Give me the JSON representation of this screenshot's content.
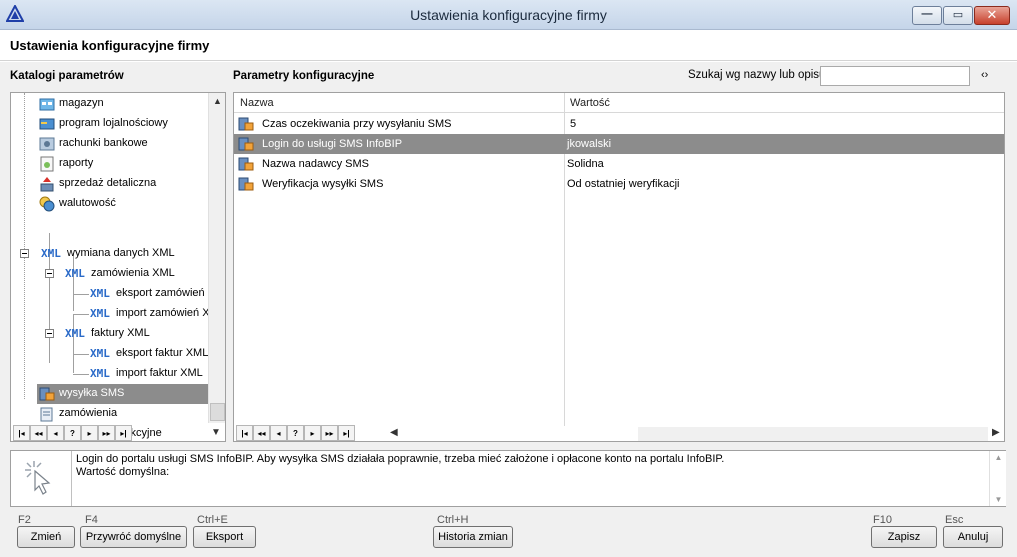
{
  "window": {
    "title": "Ustawienia konfiguracyjne firmy",
    "controls": [
      "minimize-icon",
      "maximize-icon",
      "close-icon"
    ]
  },
  "header": {
    "title": "Ustawienia konfiguracyjne firmy"
  },
  "left_panel": {
    "title": "Katalogi parametrów",
    "tree": [
      {
        "label": "magazyn",
        "icon": "warehouse-icon"
      },
      {
        "label": "program lojalnościowy",
        "icon": "loyalty-card-icon"
      },
      {
        "label": "rachunki bankowe",
        "icon": "bank-icon"
      },
      {
        "label": "raporty",
        "icon": "report-icon"
      },
      {
        "label": "sprzedaż detaliczna",
        "icon": "retail-icon"
      },
      {
        "label": "walutowość",
        "icon": "currency-icon"
      },
      {
        "label": "wymiana danych XML",
        "tag": "XML"
      },
      {
        "label": "zamówienia XML",
        "tag": "XML"
      },
      {
        "label": "eksport zamówień XML",
        "tag": "XML"
      },
      {
        "label": "import zamówień XML",
        "tag": "XML"
      },
      {
        "label": "faktury XML",
        "tag": "XML"
      },
      {
        "label": "eksport faktur XML",
        "tag": "XML"
      },
      {
        "label": "import faktur XML",
        "tag": "XML"
      },
      {
        "label": "wysyłka SMS",
        "icon": "sms-icon",
        "selected": true
      },
      {
        "label": "zamówienia",
        "icon": "orders-icon"
      },
      {
        "label": "zlecenia produkcyjne",
        "icon": "gear-icon"
      }
    ],
    "navigator": [
      "|◂",
      "◂◂",
      "◂",
      "?",
      "▸",
      "▸▸",
      "▸|"
    ]
  },
  "right_panel": {
    "title": "Parametry konfiguracyjne",
    "search": {
      "label": "Szukaj wg nazwy lub opisu",
      "value": "",
      "placeholder": ""
    },
    "columns": [
      "Nazwa",
      "Wartość"
    ],
    "rows": [
      {
        "name": "Czas oczekiwania przy wysyłaniu SMS",
        "value": "5"
      },
      {
        "name": "Login do usługi SMS InfoBIP",
        "value": "jkowalski",
        "selected": true
      },
      {
        "name": "Nazwa nadawcy SMS",
        "value": "Solidna"
      },
      {
        "name": "Weryfikacja wysyłki SMS",
        "value": "Od ostatniej weryfikacji"
      }
    ],
    "navigator": [
      "|◂",
      "◂◂",
      "◂",
      "?",
      "▸",
      "▸▸",
      "▸|"
    ]
  },
  "description": {
    "text": "Login do portalu usługi SMS InfoBIP. Aby wysyłka SMS działała poprawnie, trzeba mieć założone i opłacone konto na portalu InfoBIP.",
    "default_label": "Wartość domyślna:"
  },
  "buttons": [
    {
      "key": "F2",
      "label": "Zmień"
    },
    {
      "key": "F4",
      "label": "Przywróć domyślne"
    },
    {
      "key": "Ctrl+E",
      "label": "Eksport"
    },
    {
      "key": "Ctrl+H",
      "label": "Historia zmian"
    },
    {
      "key": "F10",
      "label": "Zapisz"
    },
    {
      "key": "Esc",
      "label": "Anuluj"
    }
  ],
  "colors": {
    "selection": "#8c8c8c",
    "xml_tag": "#2a6ac8",
    "title_bg": "#c5d5e9"
  }
}
